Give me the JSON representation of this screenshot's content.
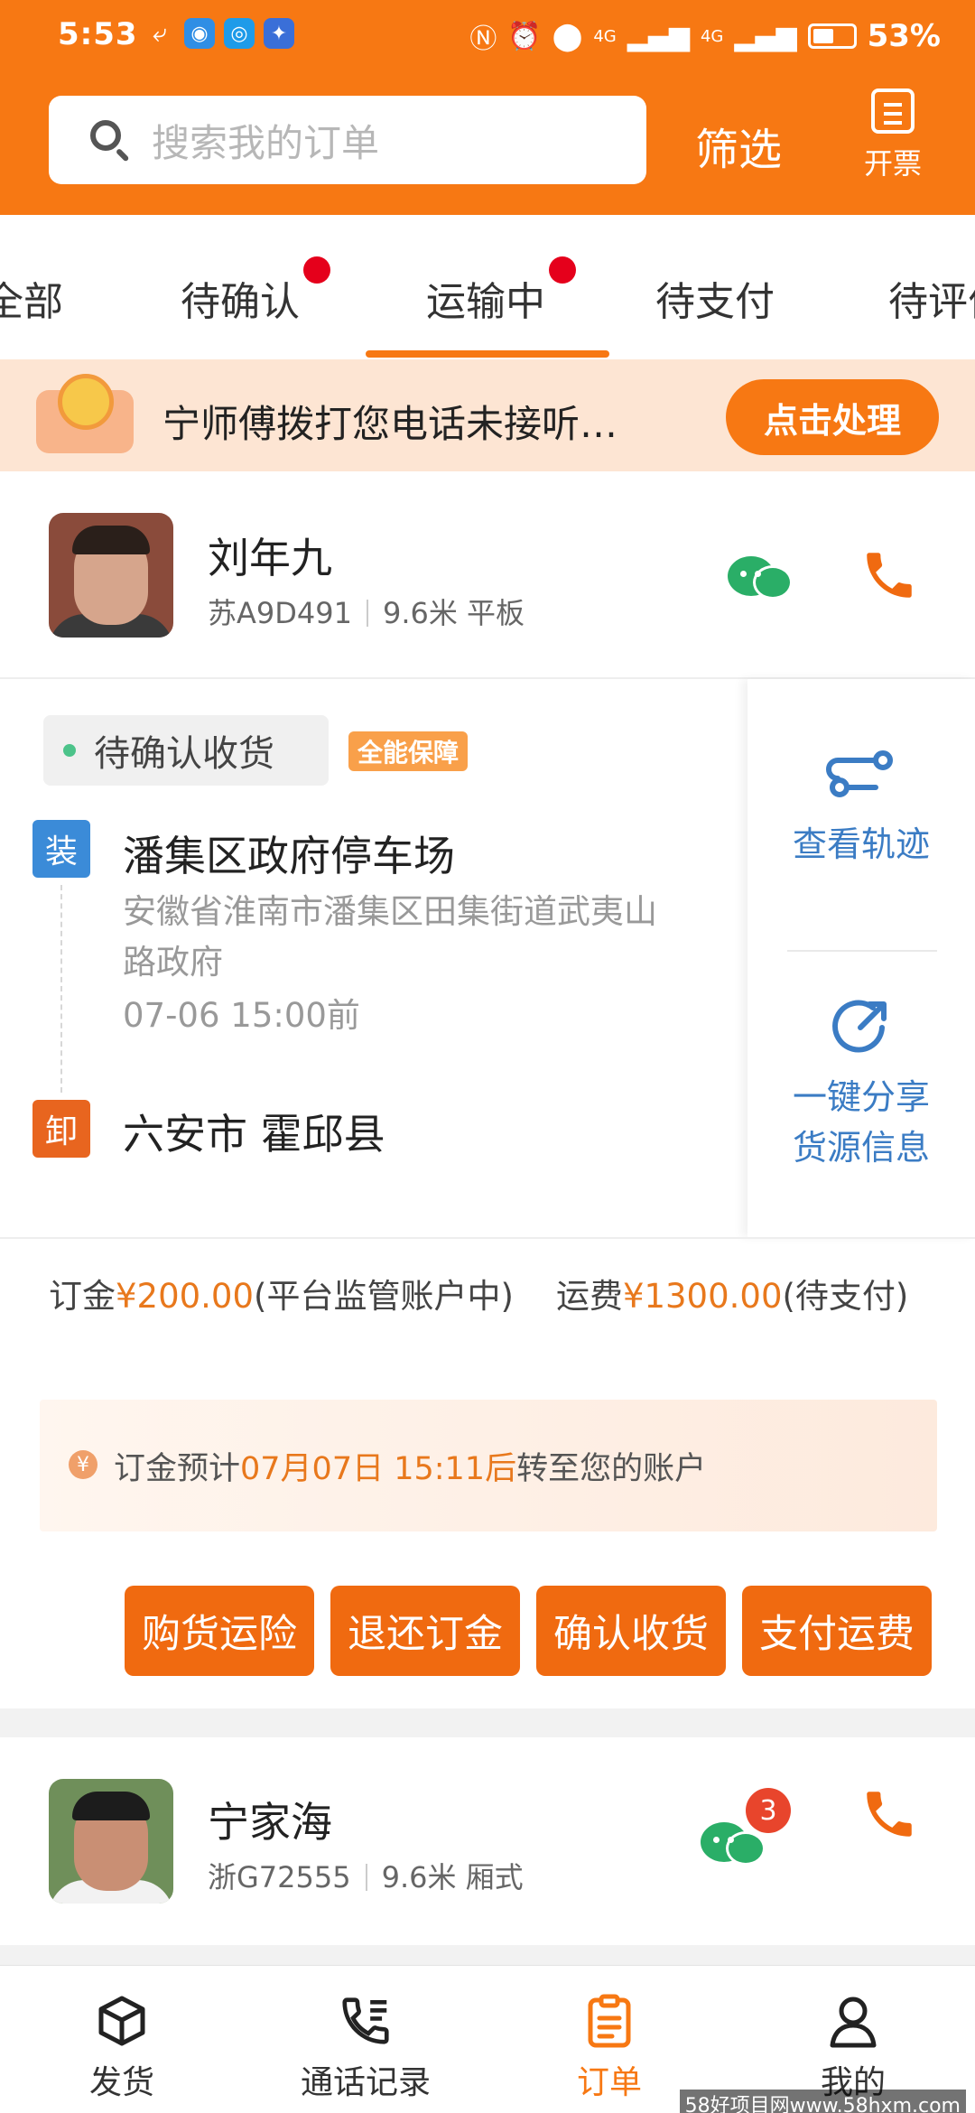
{
  "status_bar": {
    "time": "5:53",
    "network": "4G",
    "battery_level": 0.53,
    "battery_text": "53%"
  },
  "header": {
    "search_placeholder": "搜索我的订单",
    "filter_label": "筛选",
    "invoice_label": "开票"
  },
  "tabs": [
    {
      "label": "全部",
      "dot": false
    },
    {
      "label": "待确认",
      "dot": true
    },
    {
      "label": "运输中",
      "dot": true,
      "active": true
    },
    {
      "label": "待支付",
      "dot": false
    },
    {
      "label": "待评价",
      "dot": false
    }
  ],
  "notice": {
    "message": "宁师傅拨打您电话未接听…",
    "button": "点击处理"
  },
  "order": {
    "driver_name": "刘年九",
    "plate": "苏A9D491",
    "truck": "9.6米 平板",
    "status": "待确认收货",
    "guarantee": "全能保障",
    "load_tag": "装",
    "load_place": "潘集区政府停车场",
    "load_address": "安徽省淮南市潘集区田集街道武夷山路政府",
    "load_time": "07-06 15:00前",
    "unload_tag": "卸",
    "unload_place": "六安市 霍邱县",
    "view_track": "查看轨迹",
    "share_line1": "一键分享",
    "share_line2": "货源信息",
    "deposit_label": "订金",
    "deposit_amount": "¥200.00",
    "deposit_note": "(平台监管账户中)",
    "freight_label": "运费",
    "freight_amount": "¥1300.00",
    "freight_note": "(待支付)",
    "deposit_tip_prefix": "订金预计",
    "deposit_tip_time": "07月07日 15:11后",
    "deposit_tip_suffix": "转至您的账户",
    "actions": [
      "购货运险",
      "退还订金",
      "确认收货",
      "支付运费"
    ]
  },
  "order2": {
    "driver_name": "宁家海",
    "plate": "浙G72555",
    "truck": "9.6米 厢式",
    "unread": "3"
  },
  "bottom_nav": [
    {
      "label": "发货",
      "icon": "box-icon"
    },
    {
      "label": "通话记录",
      "icon": "call-log-icon"
    },
    {
      "label": "订单",
      "icon": "clipboard-icon",
      "active": true
    },
    {
      "label": "我的",
      "icon": "person-icon"
    }
  ],
  "watermark": "58好项目网www.58hxm.com",
  "colors": {
    "brand": "#f77813",
    "link_blue": "#3b7cc4",
    "wechat_green": "#2aae67",
    "alert_red": "#e5001b"
  }
}
